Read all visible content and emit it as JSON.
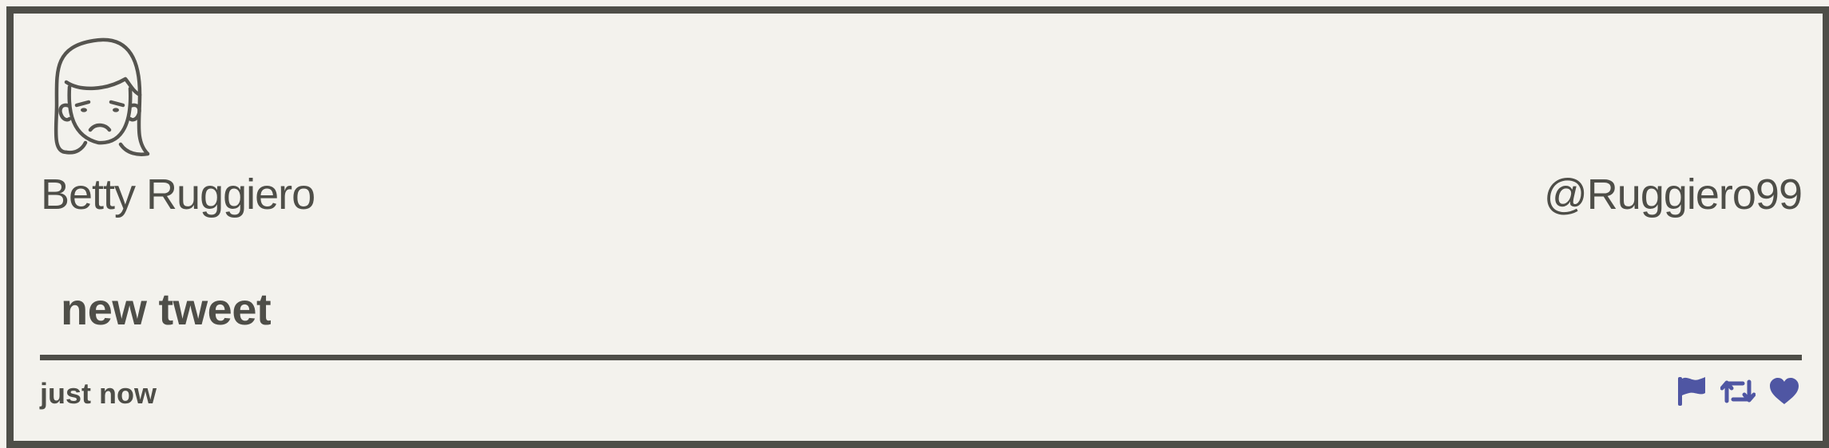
{
  "tweet": {
    "author": {
      "display_name": "Betty Ruggiero",
      "handle": "@Ruggiero99",
      "avatar_icon": "sad-woman-face-icon"
    },
    "content": "new tweet",
    "timestamp": "just now",
    "actions": [
      {
        "name": "flag",
        "icon": "flag-icon"
      },
      {
        "name": "retweet",
        "icon": "retweet-icon"
      },
      {
        "name": "like",
        "icon": "heart-icon"
      }
    ]
  },
  "colors": {
    "background": "#f3f2ed",
    "text": "#4e4e48",
    "border": "#4e4e48",
    "action_accent": "#4f56a3"
  }
}
